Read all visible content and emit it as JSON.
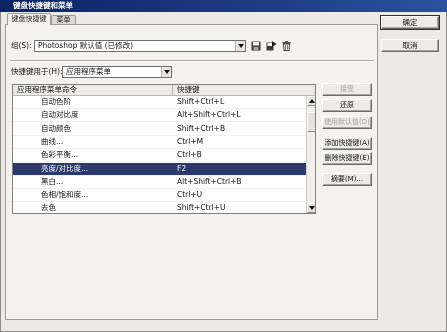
{
  "window": {
    "title": "键盘快捷键和菜单"
  },
  "tabs": [
    {
      "label": "键盘快捷键",
      "selected": true
    },
    {
      "label": "菜单",
      "selected": false
    }
  ],
  "dialog_buttons": {
    "ok": "确定",
    "cancel": "取消"
  },
  "set": {
    "label": "组(S):",
    "value": "Photoshop 默认值 (已修改)",
    "icons": [
      "save-icon",
      "save-as-icon",
      "trash-icon"
    ]
  },
  "shortcuts_for": {
    "label": "快捷键用于(H):",
    "value": "应用程序菜单"
  },
  "table": {
    "columns": [
      "应用程序菜单命令",
      "快捷键"
    ],
    "rows": [
      {
        "command": "自动色阶",
        "shortcut": "Shift+Ctrl+L"
      },
      {
        "command": "自动对比度",
        "shortcut": "Alt+Shift+Ctrl+L"
      },
      {
        "command": "自动颜色",
        "shortcut": "Shift+Ctrl+B"
      },
      {
        "command": "曲线...",
        "shortcut": "Ctrl+M"
      },
      {
        "command": "色彩平衡...",
        "shortcut": "Ctrl+B"
      },
      {
        "command": "亮度/对比度...",
        "shortcut": "F2",
        "selected": true
      },
      {
        "command": "黑白...",
        "shortcut": "Alt+Shift+Ctrl+B"
      },
      {
        "command": "色相/饱和度...",
        "shortcut": "Ctrl+U"
      },
      {
        "command": "去色",
        "shortcut": "Shift+Ctrl+U"
      }
    ],
    "scroll_position": 0.08
  },
  "side_buttons": [
    {
      "label": "接受",
      "enabled": false
    },
    {
      "label": "还原",
      "enabled": true
    },
    {
      "label": "使用默认值(D)",
      "enabled": false
    },
    {
      "label": "添加快捷键(A)",
      "enabled": true
    },
    {
      "label": "删除快捷键(E)",
      "enabled": true
    },
    {
      "label": "摘要(M)...",
      "enabled": true
    }
  ],
  "colors": {
    "title_bar": "#0a2466",
    "selection": "#2b3a6b",
    "selection_text": "#ffffff",
    "disabled_text": "#a3a3a3"
  }
}
